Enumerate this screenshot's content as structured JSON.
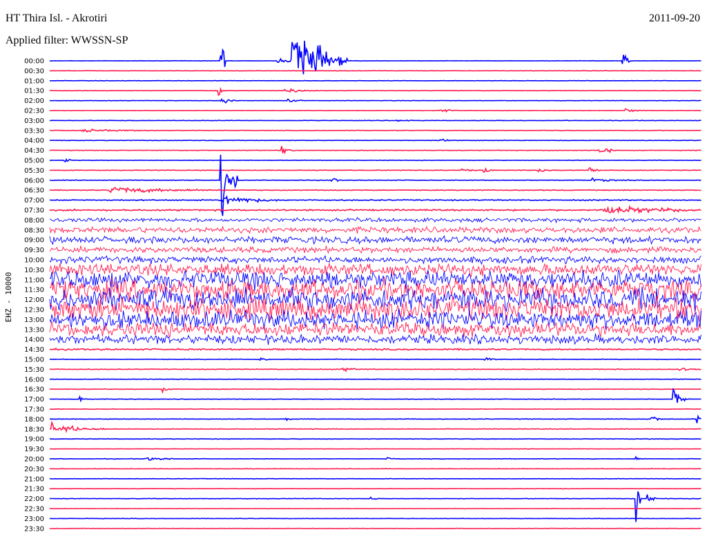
{
  "header": {
    "title": "HT Thira Isl. - Akrotiri",
    "filter": "Applied filter: WWSSN-SP",
    "date": "2011-09-20"
  },
  "chart_data": {
    "type": "line",
    "title": "HT Thira Isl. - Akrotiri",
    "subtitle": "Applied filter: WWSSN-SP",
    "ylabel": "EHZ - 10000",
    "xlabel": "",
    "trace_colors": [
      "#0000ff",
      "#ff1a4d"
    ],
    "grid": false,
    "rows": [
      {
        "label": "00:00",
        "noise": 0.4
      },
      {
        "label": "00:30",
        "noise": 0.4
      },
      {
        "label": "01:00",
        "noise": 0.4
      },
      {
        "label": "01:30",
        "noise": 0.4
      },
      {
        "label": "02:00",
        "noise": 0.4
      },
      {
        "label": "02:30",
        "noise": 0.4
      },
      {
        "label": "03:00",
        "noise": 0.5
      },
      {
        "label": "03:30",
        "noise": 0.5
      },
      {
        "label": "04:00",
        "noise": 0.5
      },
      {
        "label": "04:30",
        "noise": 0.5
      },
      {
        "label": "05:00",
        "noise": 0.5
      },
      {
        "label": "05:30",
        "noise": 0.6
      },
      {
        "label": "06:00",
        "noise": 0.6
      },
      {
        "label": "06:30",
        "noise": 0.8
      },
      {
        "label": "07:00",
        "noise": 1.0
      },
      {
        "label": "07:30",
        "noise": 1.5
      },
      {
        "label": "08:00",
        "noise": 4.0
      },
      {
        "label": "08:30",
        "noise": 6.0
      },
      {
        "label": "09:00",
        "noise": 7.0
      },
      {
        "label": "09:30",
        "noise": 6.0
      },
      {
        "label": "10:00",
        "noise": 7.0
      },
      {
        "label": "10:30",
        "noise": 12.0
      },
      {
        "label": "11:00",
        "noise": 18.0
      },
      {
        "label": "11:30",
        "noise": 20.0
      },
      {
        "label": "12:00",
        "noise": 22.0
      },
      {
        "label": "12:30",
        "noise": 22.0
      },
      {
        "label": "13:00",
        "noise": 18.0
      },
      {
        "label": "13:30",
        "noise": 14.0
      },
      {
        "label": "14:00",
        "noise": 9.0
      },
      {
        "label": "14:30",
        "noise": 1.5
      },
      {
        "label": "15:00",
        "noise": 0.6
      },
      {
        "label": "15:30",
        "noise": 0.6
      },
      {
        "label": "16:00",
        "noise": 0.5
      },
      {
        "label": "16:30",
        "noise": 0.5
      },
      {
        "label": "17:00",
        "noise": 0.5
      },
      {
        "label": "17:30",
        "noise": 0.5
      },
      {
        "label": "18:00",
        "noise": 0.5
      },
      {
        "label": "18:30",
        "noise": 0.6
      },
      {
        "label": "19:00",
        "noise": 0.5
      },
      {
        "label": "19:30",
        "noise": 0.4
      },
      {
        "label": "20:00",
        "noise": 0.5
      },
      {
        "label": "20:30",
        "noise": 0.4
      },
      {
        "label": "21:00",
        "noise": 0.4
      },
      {
        "label": "21:30",
        "noise": 0.4
      },
      {
        "label": "22:00",
        "noise": 0.5
      },
      {
        "label": "22:30",
        "noise": 0.4
      },
      {
        "label": "23:00",
        "noise": 0.4
      },
      {
        "label": "23:30",
        "noise": 0.4
      }
    ],
    "events": [
      {
        "row": "00:00",
        "minute": 10.5,
        "amp": 4,
        "dur": 1.5
      },
      {
        "row": "00:00",
        "minute": 11.2,
        "amp": 90,
        "dur": 2.5
      },
      {
        "row": "00:00",
        "minute": 26.4,
        "amp": 28,
        "dur": 0.3
      },
      {
        "row": "00:00",
        "minute": 7.9,
        "amp": 50,
        "dur": 0.2
      },
      {
        "row": "01:30",
        "minute": 10.8,
        "amp": 6,
        "dur": 1.5
      },
      {
        "row": "01:30",
        "minute": 7.8,
        "amp": 10,
        "dur": 0.3
      },
      {
        "row": "02:00",
        "minute": 7.9,
        "amp": 14,
        "dur": 0.6
      },
      {
        "row": "02:00",
        "minute": 11.0,
        "amp": 5,
        "dur": 0.6
      },
      {
        "row": "02:30",
        "minute": 18.0,
        "amp": 5,
        "dur": 0.8
      },
      {
        "row": "02:30",
        "minute": 26.5,
        "amp": 4,
        "dur": 1.0
      },
      {
        "row": "02:30",
        "minute": 30.5,
        "amp": 4,
        "dur": 0.8
      },
      {
        "row": "03:00",
        "minute": 16.0,
        "amp": 3,
        "dur": 0.8
      },
      {
        "row": "03:30",
        "minute": 1.5,
        "amp": 3,
        "dur": 3.5
      },
      {
        "row": "04:00",
        "minute": 18.0,
        "amp": 4,
        "dur": 0.4
      },
      {
        "row": "04:30",
        "minute": 10.7,
        "amp": 8,
        "dur": 0.6
      },
      {
        "row": "04:30",
        "minute": 25.3,
        "amp": 12,
        "dur": 0.8
      },
      {
        "row": "05:00",
        "minute": 0.7,
        "amp": 6,
        "dur": 0.4
      },
      {
        "row": "05:30",
        "minute": 19.0,
        "amp": 4,
        "dur": 0.6
      },
      {
        "row": "05:30",
        "minute": 20.0,
        "amp": 4,
        "dur": 0.6
      },
      {
        "row": "05:30",
        "minute": 22.5,
        "amp": 4,
        "dur": 0.6
      },
      {
        "row": "05:30",
        "minute": 24.8,
        "amp": 8,
        "dur": 0.5
      },
      {
        "row": "06:00",
        "minute": 13.0,
        "amp": 6,
        "dur": 0.4
      },
      {
        "row": "06:00",
        "minute": 25.0,
        "amp": 3,
        "dur": 2.0
      },
      {
        "row": "06:00",
        "minute": 7.9,
        "amp": 100,
        "dur": 0.8
      },
      {
        "row": "06:30",
        "minute": 2.8,
        "amp": 7,
        "dur": 5.5
      },
      {
        "row": "07:00",
        "minute": 8.0,
        "amp": 12,
        "dur": 2.5
      },
      {
        "row": "07:30",
        "minute": 25.5,
        "amp": 8,
        "dur": 6.0
      },
      {
        "row": "15:00",
        "minute": 9.7,
        "amp": 4,
        "dur": 0.4
      },
      {
        "row": "15:00",
        "minute": 20.0,
        "amp": 4,
        "dur": 1.0
      },
      {
        "row": "15:30",
        "minute": 13.5,
        "amp": 4,
        "dur": 1.0
      },
      {
        "row": "15:30",
        "minute": 29.0,
        "amp": 4,
        "dur": 1.0
      },
      {
        "row": "16:30",
        "minute": 5.2,
        "amp": 5,
        "dur": 0.4
      },
      {
        "row": "17:00",
        "minute": 1.4,
        "amp": 14,
        "dur": 0.3
      },
      {
        "row": "17:00",
        "minute": 28.7,
        "amp": 22,
        "dur": 0.6
      },
      {
        "row": "18:00",
        "minute": 10.9,
        "amp": 5,
        "dur": 0.4
      },
      {
        "row": "18:00",
        "minute": 27.7,
        "amp": 10,
        "dur": 0.5
      },
      {
        "row": "18:00",
        "minute": 29.8,
        "amp": 10,
        "dur": 0.5
      },
      {
        "row": "18:30",
        "minute": 0.1,
        "amp": 12,
        "dur": 2.5
      },
      {
        "row": "20:00",
        "minute": 4.4,
        "amp": 4,
        "dur": 2.0
      },
      {
        "row": "20:00",
        "minute": 15.5,
        "amp": 4,
        "dur": 0.4
      },
      {
        "row": "20:00",
        "minute": 27.0,
        "amp": 3,
        "dur": 0.4
      },
      {
        "row": "22:00",
        "minute": 14.8,
        "amp": 4,
        "dur": 0.3
      },
      {
        "row": "22:00",
        "minute": 27.5,
        "amp": 10,
        "dur": 0.5
      },
      {
        "row": "22:00",
        "minute": 27.0,
        "amp": 60,
        "dur": 0.2
      }
    ]
  }
}
